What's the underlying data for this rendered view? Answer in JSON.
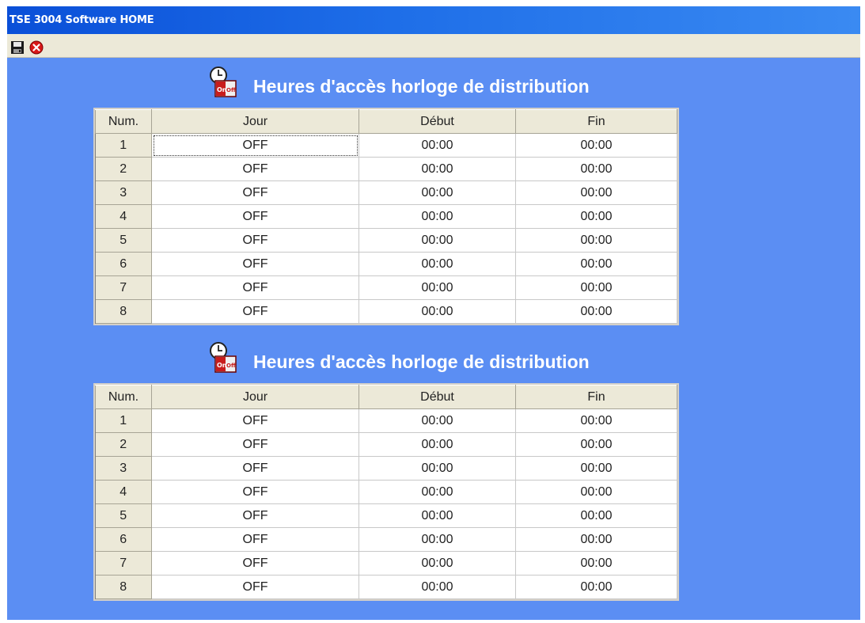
{
  "window": {
    "title": "TSE 3004 Software HOME"
  },
  "toolbar": {
    "save_icon": "save-icon",
    "close_icon": "close-icon"
  },
  "sections": [
    {
      "heading": "Heures d'accès horloge de distribution",
      "columns": [
        "Num.",
        "Jour",
        "Début",
        "Fin"
      ],
      "rows": [
        [
          "1",
          "OFF",
          "00:00",
          "00:00"
        ],
        [
          "2",
          "OFF",
          "00:00",
          "00:00"
        ],
        [
          "3",
          "OFF",
          "00:00",
          "00:00"
        ],
        [
          "4",
          "OFF",
          "00:00",
          "00:00"
        ],
        [
          "5",
          "OFF",
          "00:00",
          "00:00"
        ],
        [
          "6",
          "OFF",
          "00:00",
          "00:00"
        ],
        [
          "7",
          "OFF",
          "00:00",
          "00:00"
        ],
        [
          "8",
          "OFF",
          "00:00",
          "00:00"
        ]
      ]
    },
    {
      "heading": "Heures d'accès horloge de distribution",
      "columns": [
        "Num.",
        "Jour",
        "Début",
        "Fin"
      ],
      "rows": [
        [
          "1",
          "OFF",
          "00:00",
          "00:00"
        ],
        [
          "2",
          "OFF",
          "00:00",
          "00:00"
        ],
        [
          "3",
          "OFF",
          "00:00",
          "00:00"
        ],
        [
          "4",
          "OFF",
          "00:00",
          "00:00"
        ],
        [
          "5",
          "OFF",
          "00:00",
          "00:00"
        ],
        [
          "6",
          "OFF",
          "00:00",
          "00:00"
        ],
        [
          "7",
          "OFF",
          "00:00",
          "00:00"
        ],
        [
          "8",
          "OFF",
          "00:00",
          "00:00"
        ]
      ]
    }
  ],
  "colors": {
    "background": "#5b8ef3",
    "titlebar": "#1e6ee8",
    "header_cell": "#ece9d8"
  }
}
